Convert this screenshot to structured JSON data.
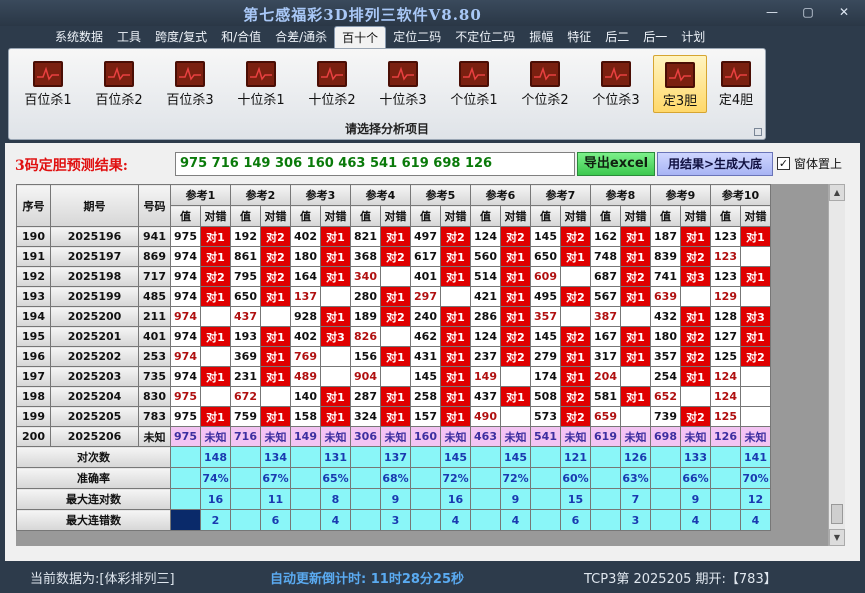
{
  "window": {
    "title": "第七感福彩3D排列三软件V8.80",
    "buttons": [
      "—",
      "▢",
      "✕"
    ]
  },
  "menu": [
    "系统数据",
    "工具",
    "跨度/复式",
    "和/合值",
    "合差/通杀",
    "百十个",
    "定位二码",
    "不定位二码",
    "振幅",
    "特征",
    "后二",
    "后一",
    "计划"
  ],
  "menu_active_index": 5,
  "ribbon": {
    "buttons": [
      "百位杀1",
      "百位杀2",
      "百位杀3",
      "十位杀1",
      "十位杀2",
      "十位杀3",
      "个位杀1",
      "个位杀2",
      "个位杀3",
      "定3胆",
      "定4胆"
    ],
    "active_index": 9,
    "footer": "请选择分析项目"
  },
  "result": {
    "label": "3码定胆预测结果:",
    "value": "975 716 149 306 160 463 541 619 698 126",
    "export_button": "导出excel",
    "generate_button": "用结果>生成大底",
    "checkbox_label": "窗体置上",
    "checkbox_checked": true
  },
  "table": {
    "headers": {
      "seq": "序号",
      "period": "期号",
      "number": "号码",
      "value": "值",
      "hit": "对错"
    },
    "ref_labels": [
      "参考1",
      "参考2",
      "参考3",
      "参考4",
      "参考5",
      "参考6",
      "参考7",
      "参考8",
      "参考9",
      "参考10"
    ],
    "rows": [
      {
        "seq": "190",
        "period": "2025196",
        "number": "941",
        "cells": [
          [
            "975",
            "对1"
          ],
          [
            "192",
            "对2"
          ],
          [
            "402",
            "对1"
          ],
          [
            "821",
            "对1"
          ],
          [
            "497",
            "对2"
          ],
          [
            "124",
            "对2"
          ],
          [
            "145",
            "对2"
          ],
          [
            "162",
            "对1"
          ],
          [
            "187",
            "对1"
          ],
          [
            "123",
            "对1"
          ]
        ]
      },
      {
        "seq": "191",
        "period": "2025197",
        "number": "869",
        "cells": [
          [
            "974",
            "对1"
          ],
          [
            "861",
            "对2"
          ],
          [
            "180",
            "对1"
          ],
          [
            "368",
            "对2"
          ],
          [
            "617",
            "对1"
          ],
          [
            "560",
            "对1"
          ],
          [
            "650",
            "对1"
          ],
          [
            "748",
            "对1"
          ],
          [
            "839",
            "对2"
          ],
          [
            "123",
            ""
          ]
        ]
      },
      {
        "seq": "192",
        "period": "2025198",
        "number": "717",
        "cells": [
          [
            "974",
            "对2"
          ],
          [
            "795",
            "对2"
          ],
          [
            "164",
            "对1"
          ],
          [
            "340",
            ""
          ],
          [
            "401",
            "对1"
          ],
          [
            "514",
            "对1"
          ],
          [
            "609",
            ""
          ],
          [
            "687",
            "对2"
          ],
          [
            "741",
            "对3"
          ],
          [
            "123",
            "对1"
          ]
        ]
      },
      {
        "seq": "193",
        "period": "2025199",
        "number": "485",
        "cells": [
          [
            "974",
            "对1"
          ],
          [
            "650",
            "对1"
          ],
          [
            "137",
            ""
          ],
          [
            "280",
            "对1"
          ],
          [
            "297",
            ""
          ],
          [
            "421",
            "对1"
          ],
          [
            "495",
            "对2"
          ],
          [
            "567",
            "对1"
          ],
          [
            "639",
            ""
          ],
          [
            "129",
            ""
          ]
        ]
      },
      {
        "seq": "194",
        "period": "2025200",
        "number": "211",
        "cells": [
          [
            "974",
            ""
          ],
          [
            "437",
            ""
          ],
          [
            "928",
            "对1"
          ],
          [
            "189",
            "对2"
          ],
          [
            "240",
            "对1"
          ],
          [
            "286",
            "对1"
          ],
          [
            "357",
            ""
          ],
          [
            "387",
            ""
          ],
          [
            "432",
            "对1"
          ],
          [
            "128",
            "对3"
          ]
        ]
      },
      {
        "seq": "195",
        "period": "2025201",
        "number": "401",
        "cells": [
          [
            "974",
            "对1"
          ],
          [
            "193",
            "对1"
          ],
          [
            "402",
            "对3"
          ],
          [
            "826",
            ""
          ],
          [
            "462",
            "对1"
          ],
          [
            "124",
            "对2"
          ],
          [
            "145",
            "对2"
          ],
          [
            "167",
            "对1"
          ],
          [
            "180",
            "对2"
          ],
          [
            "127",
            "对1"
          ]
        ]
      },
      {
        "seq": "196",
        "period": "2025202",
        "number": "253",
        "cells": [
          [
            "974",
            ""
          ],
          [
            "369",
            "对1"
          ],
          [
            "769",
            ""
          ],
          [
            "156",
            "对1"
          ],
          [
            "431",
            "对1"
          ],
          [
            "237",
            "对2"
          ],
          [
            "279",
            "对1"
          ],
          [
            "317",
            "对1"
          ],
          [
            "357",
            "对2"
          ],
          [
            "125",
            "对2"
          ]
        ]
      },
      {
        "seq": "197",
        "period": "2025203",
        "number": "735",
        "cells": [
          [
            "974",
            "对1"
          ],
          [
            "231",
            "对1"
          ],
          [
            "489",
            ""
          ],
          [
            "904",
            ""
          ],
          [
            "145",
            "对1"
          ],
          [
            "149",
            ""
          ],
          [
            "174",
            "对1"
          ],
          [
            "204",
            ""
          ],
          [
            "254",
            "对1"
          ],
          [
            "124",
            ""
          ]
        ]
      },
      {
        "seq": "198",
        "period": "2025204",
        "number": "830",
        "cells": [
          [
            "975",
            ""
          ],
          [
            "672",
            ""
          ],
          [
            "140",
            "对1"
          ],
          [
            "287",
            "对1"
          ],
          [
            "258",
            "对1"
          ],
          [
            "437",
            "对1"
          ],
          [
            "508",
            "对2"
          ],
          [
            "581",
            "对1"
          ],
          [
            "652",
            ""
          ],
          [
            "124",
            ""
          ]
        ]
      },
      {
        "seq": "199",
        "period": "2025205",
        "number": "783",
        "cells": [
          [
            "975",
            "对1"
          ],
          [
            "759",
            "对1"
          ],
          [
            "158",
            "对1"
          ],
          [
            "324",
            "对1"
          ],
          [
            "157",
            "对1"
          ],
          [
            "490",
            ""
          ],
          [
            "573",
            "对2"
          ],
          [
            "659",
            ""
          ],
          [
            "739",
            "对2"
          ],
          [
            "125",
            ""
          ]
        ]
      }
    ],
    "predict_row": {
      "seq": "200",
      "period": "2025206",
      "number": "未知",
      "cells": [
        [
          "975",
          "未知"
        ],
        [
          "716",
          "未知"
        ],
        [
          "149",
          "未知"
        ],
        [
          "306",
          "未知"
        ],
        [
          "160",
          "未知"
        ],
        [
          "463",
          "未知"
        ],
        [
          "541",
          "未知"
        ],
        [
          "619",
          "未知"
        ],
        [
          "698",
          "未知"
        ],
        [
          "126",
          "未知"
        ]
      ]
    },
    "stats": [
      {
        "label": "对次数",
        "values": [
          "148",
          "134",
          "131",
          "137",
          "145",
          "145",
          "121",
          "126",
          "133",
          "141"
        ]
      },
      {
        "label": "准确率",
        "values": [
          "74%",
          "67%",
          "65%",
          "68%",
          "72%",
          "72%",
          "60%",
          "63%",
          "66%",
          "70%"
        ]
      },
      {
        "label": "最大连对数",
        "values": [
          "16",
          "11",
          "8",
          "9",
          "16",
          "9",
          "15",
          "7",
          "9",
          "12"
        ]
      },
      {
        "label": "最大连错数",
        "values": [
          "2",
          "6",
          "4",
          "3",
          "4",
          "4",
          "6",
          "3",
          "4",
          "4"
        ]
      }
    ]
  },
  "status": {
    "data_source": "当前数据为:[体彩排列三]",
    "countdown": "自动更新倒计时: 11时28分25秒",
    "draw_info": "TCP3第 2025205 期开:【783】"
  },
  "colors": {
    "hit_red": "#e00000",
    "result_green": "#0a7a0a",
    "stat_cyan": "#8af6f8",
    "predict_pink": "#f3c4f3"
  }
}
